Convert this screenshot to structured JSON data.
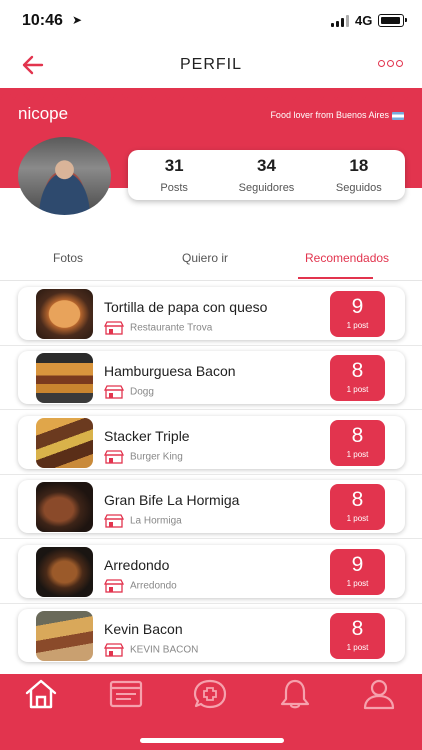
{
  "status": {
    "time": "10:46",
    "network": "4G"
  },
  "nav": {
    "title": "PERFIL"
  },
  "profile": {
    "username": "nicope",
    "bio": "Food lover from Buenos Aires",
    "stats": [
      {
        "value": "31",
        "label": "Posts"
      },
      {
        "value": "34",
        "label": "Seguidores"
      },
      {
        "value": "18",
        "label": "Seguidos"
      }
    ]
  },
  "tabs": [
    {
      "label": "Fotos",
      "active": false
    },
    {
      "label": "Quiero ir",
      "active": false
    },
    {
      "label": "Recomendados",
      "active": true
    }
  ],
  "recommendations": [
    {
      "dish": "Tortilla de papa con queso",
      "restaurant": "Restaurante Trova",
      "score": "9",
      "posts": "1 post"
    },
    {
      "dish": "Hamburguesa Bacon",
      "restaurant": "Dogg",
      "score": "8",
      "posts": "1 post"
    },
    {
      "dish": "Stacker Triple",
      "restaurant": "Burger King",
      "score": "8",
      "posts": "1 post"
    },
    {
      "dish": "Gran Bife La Hormiga",
      "restaurant": "La Hormiga",
      "score": "8",
      "posts": "1 post"
    },
    {
      "dish": "Arredondo",
      "restaurant": "Arredondo",
      "score": "9",
      "posts": "1 post"
    },
    {
      "dish": "Kevin Bacon",
      "restaurant": "KEVIN BACON",
      "score": "8",
      "posts": "1 post"
    }
  ],
  "tabbar": {
    "items": [
      "home-icon",
      "feed-icon",
      "add-post-icon",
      "notifications-icon",
      "profile-icon"
    ],
    "active": "home-icon"
  },
  "colors": {
    "accent": "#e2344e",
    "background": "#ffffff"
  }
}
